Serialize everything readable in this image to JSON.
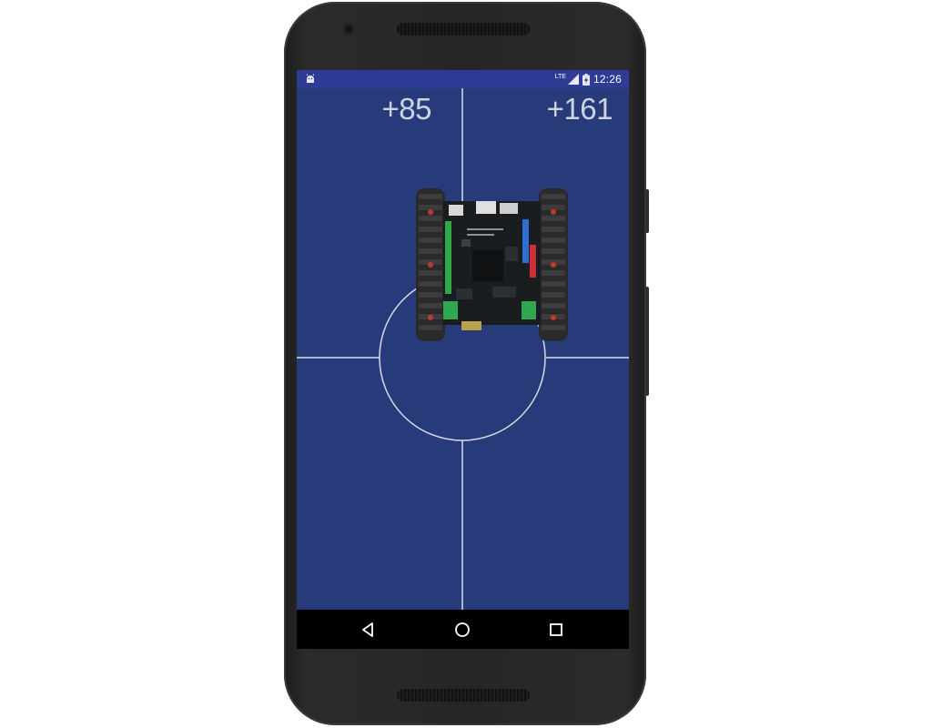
{
  "status_bar": {
    "network_label": "LTE",
    "time": "12:26"
  },
  "joystick": {
    "left_speed": "+85",
    "right_speed": "+161",
    "robot_image": "tracked-robot-board-image"
  },
  "navigation": {
    "back": "back-icon",
    "home": "home-icon",
    "recents": "recents-icon"
  },
  "colors": {
    "screen_bg": "#273b7a",
    "status_bar_bg": "#2f3c96",
    "line_color": "#d8dbe6",
    "speed_text": "#cfd3e0"
  }
}
